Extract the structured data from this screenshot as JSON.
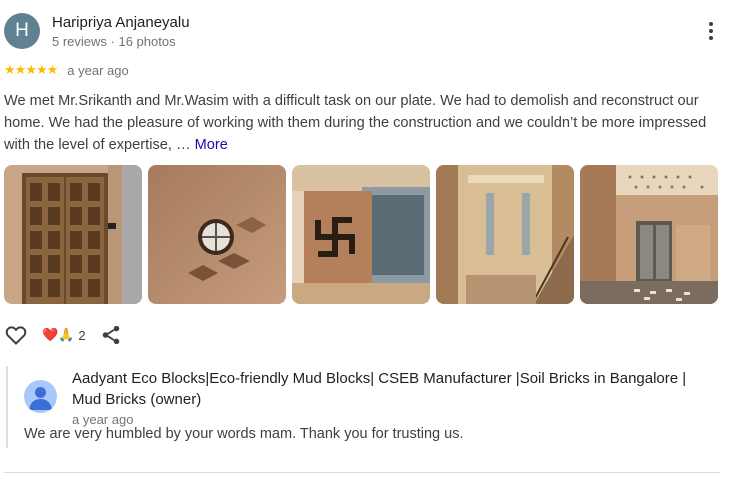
{
  "reviewer": {
    "initial": "H",
    "name": "Haripriya Anjaneyalu",
    "meta": "5 reviews · 16 photos"
  },
  "review": {
    "rating": 5,
    "stars": "★★★★★",
    "time": "a year ago",
    "text": "We met Mr.Srikanth and Mr.Wasim with a difficult task on our plate. We had to demolish and reconstruct our home. We had the pleasure of working with them during the construction and we couldn’t be more impressed with the level of expertise, … ",
    "more_label": "More"
  },
  "photos": [
    {
      "icon": "door-photo"
    },
    {
      "icon": "wall-window-photo"
    },
    {
      "icon": "swastik-panel-photo"
    },
    {
      "icon": "staircase-photo"
    },
    {
      "icon": "interior-hall-photo"
    }
  ],
  "actions": {
    "reaction_emojis": "❤️🙏",
    "reaction_count": "2"
  },
  "owner_reply": {
    "name": "Aadyant Eco Blocks|Eco-friendly Mud Blocks| CSEB Manufacturer |Soil Bricks in Bangalore | Mud Bricks (owner)",
    "time": "a year ago",
    "text": "We are very humbled by your words mam. Thank you for trusting us."
  },
  "colors": {
    "star": "#fbbc04",
    "link": "#1a0dab",
    "avatar_bg": "#5f8191",
    "owner_avatar_bg": "#a8c7fa"
  }
}
